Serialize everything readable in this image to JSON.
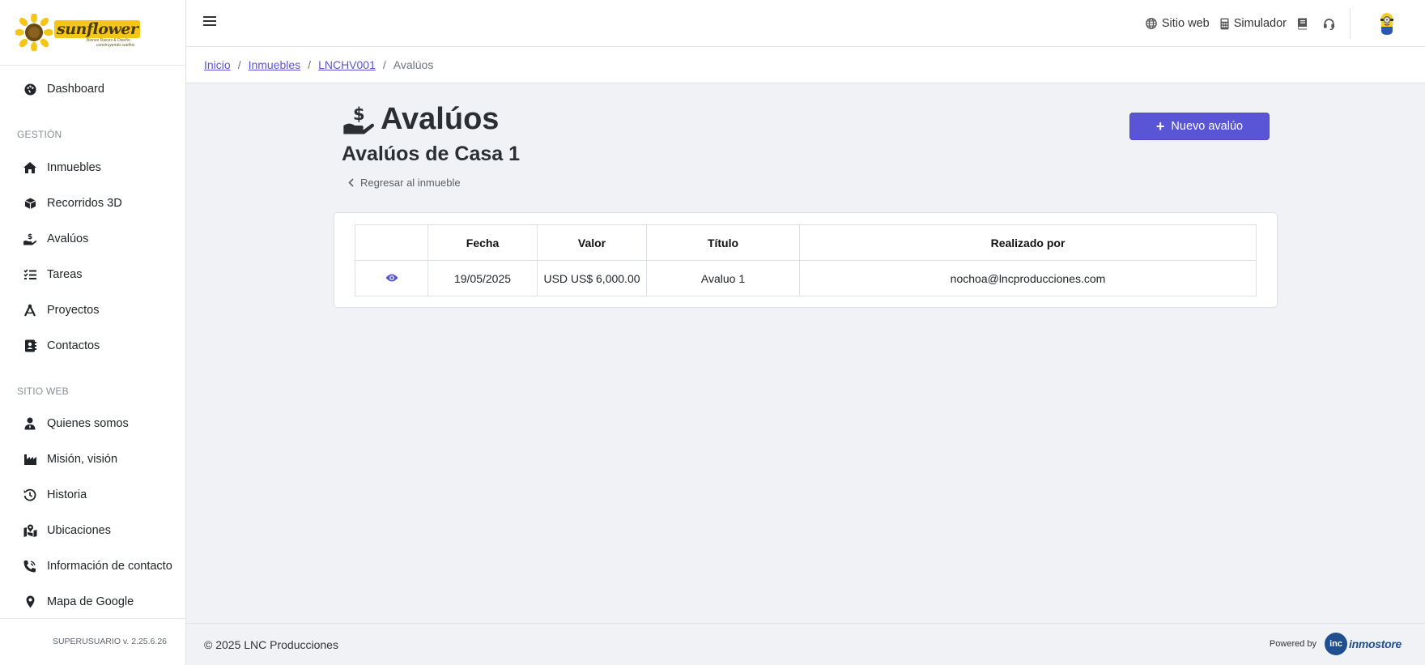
{
  "brand": {
    "logo_text": "sunflower",
    "logo_tagline1": "Bienes Raices & Diseño",
    "logo_tagline2": "construyendo sueños"
  },
  "sidebar": {
    "items_top": [
      {
        "label": "Dashboard",
        "icon": "palette-icon"
      }
    ],
    "section_gestion": "GESTIÓN",
    "items_gestion": [
      {
        "label": "Inmuebles",
        "icon": "home-icon"
      },
      {
        "label": "Recorridos 3D",
        "icon": "cube-icon"
      },
      {
        "label": "Avalúos",
        "icon": "hand-dollar-icon"
      },
      {
        "label": "Tareas",
        "icon": "list-check-icon"
      },
      {
        "label": "Proyectos",
        "icon": "compass-icon"
      },
      {
        "label": "Contactos",
        "icon": "address-book-icon"
      }
    ],
    "section_web": "SITIO WEB",
    "items_web": [
      {
        "label": "Quienes somos",
        "icon": "user-tie-icon"
      },
      {
        "label": "Misión, visión",
        "icon": "industry-icon"
      },
      {
        "label": "Historia",
        "icon": "history-icon"
      },
      {
        "label": "Ubicaciones",
        "icon": "map-location-icon"
      },
      {
        "label": "Información de contacto",
        "icon": "phone-volume-icon"
      },
      {
        "label": "Mapa de Google",
        "icon": "map-pin-icon"
      }
    ],
    "version": "SUPERUSUARIO v. 2.25.6.26"
  },
  "topbar": {
    "links": [
      {
        "label": "Sitio web",
        "icon": "globe-icon"
      },
      {
        "label": "Simulador",
        "icon": "calculator-icon"
      }
    ],
    "book_icon": "book-icon",
    "support_icon": "headset-icon"
  },
  "breadcrumb": {
    "items": [
      "Inicio",
      "Inmuebles",
      "LNCHV001"
    ],
    "current": "Avalúos",
    "separator": "/"
  },
  "page": {
    "title": "Avalúos",
    "subtitle": "Avalúos de Casa 1",
    "back_label": "Regresar al inmueble",
    "new_button": "Nuevo avalúo"
  },
  "table": {
    "headers": [
      "",
      "Fecha",
      "Valor",
      "Título",
      "Realizado por"
    ],
    "rows": [
      {
        "fecha": "19/05/2025",
        "valor": "USD US$ 6,000.00",
        "titulo": "Avaluo 1",
        "realizado_por": "nochoa@lncproducciones.com"
      }
    ]
  },
  "footer": {
    "copyright": "© 2025 LNC Producciones",
    "powered_by": "Powered by",
    "powered_brand": "inmostore",
    "powered_mark": "inc"
  },
  "colors": {
    "accent": "#5a55d6",
    "background": "#f1f2f6"
  }
}
